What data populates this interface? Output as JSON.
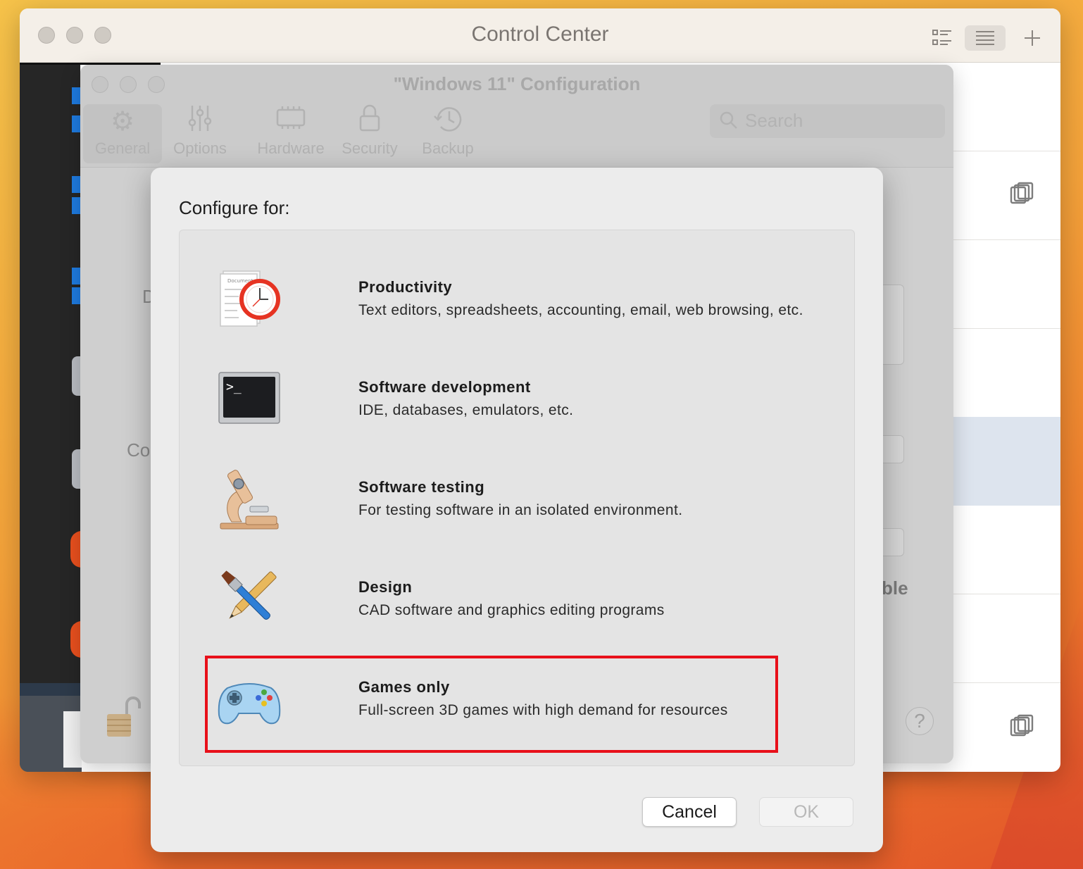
{
  "control_center": {
    "title": "Control Center",
    "toolbar": {
      "list_view_icon": "list-view-icon",
      "menu_icon": "menu-icon",
      "add_icon": "plus-icon"
    }
  },
  "config_window": {
    "title": "\"Windows 11\" Configuration",
    "tabs": [
      {
        "label": "General",
        "icon": "gear-icon"
      },
      {
        "label": "Options",
        "icon": "sliders-icon"
      },
      {
        "label": "Hardware",
        "icon": "chip-icon"
      },
      {
        "label": "Security",
        "icon": "lock-icon"
      },
      {
        "label": "Backup",
        "icon": "clock-icon"
      }
    ],
    "search_placeholder": "Search",
    "partial_text": {
      "d": "D",
      "co": "Co",
      "ble": "ble"
    },
    "help_label": "?"
  },
  "sheet": {
    "heading": "Configure for:",
    "options": [
      {
        "title": "Productivity",
        "description": "Text editors, spreadsheets, accounting, email, web browsing, etc.",
        "icon": "productivity-icon",
        "doc_label": "Document"
      },
      {
        "title": "Software development",
        "description": "IDE, databases, emulators, etc.",
        "icon": "terminal-icon",
        "prompt": ">_"
      },
      {
        "title": "Software testing",
        "description": "For testing software in an isolated environment.",
        "icon": "microscope-icon"
      },
      {
        "title": "Design",
        "description": "CAD software and graphics editing programs",
        "icon": "brush-pencil-icon"
      },
      {
        "title": "Games only",
        "description": "Full-screen 3D games with high demand for resources",
        "icon": "gamepad-icon",
        "selected": true
      }
    ],
    "cancel_label": "Cancel",
    "ok_label": "OK"
  },
  "colors": {
    "selection_outline": "#e8101a",
    "accent_blue": "#1e7be0"
  }
}
